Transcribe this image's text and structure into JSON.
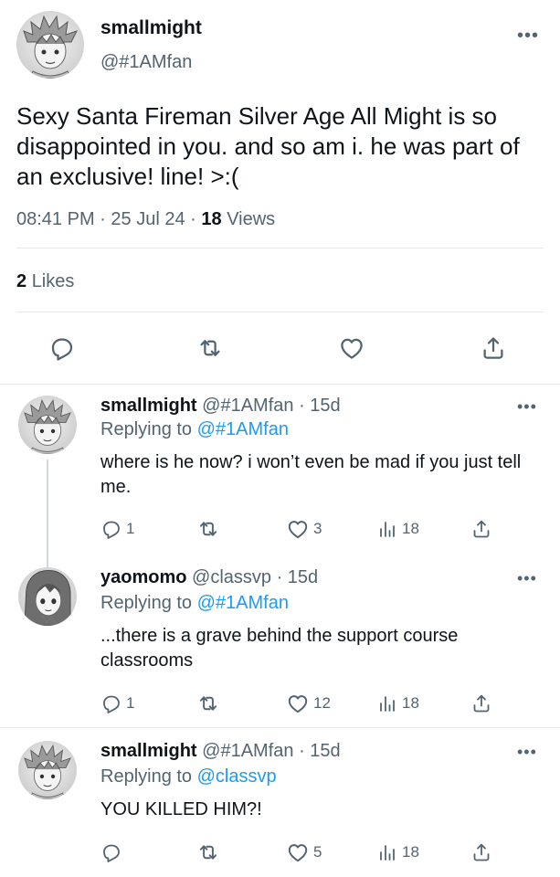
{
  "main": {
    "name": "smallmight",
    "handle": "@#1AMfan",
    "text": "Sexy Santa Fireman Silver Age All Might is so disappointed in you. and so am i. he was part of an exclusive! line! >:(",
    "time": "08:41 PM",
    "date": "25 Jul 24",
    "views_count": "18",
    "views_label": "Views",
    "likes_count": "2",
    "likes_label": "Likes",
    "separator": "·"
  },
  "replies": [
    {
      "name": "smallmight",
      "handle": "@#1AMfan",
      "age": "· 15d",
      "replying_label": "Replying to",
      "replying_to": "@#1AMfan",
      "text": "where is he now? i won’t even be mad if you just tell me.",
      "reply_count": "1",
      "retweet_count": "",
      "like_count": "3",
      "view_count": "18"
    },
    {
      "name": "yaomomo",
      "handle": "@classvp",
      "age": "· 15d",
      "replying_label": "Replying to",
      "replying_to": "@#1AMfan",
      "text": "...there is a grave behind the support course classrooms",
      "reply_count": "1",
      "retweet_count": "",
      "like_count": "12",
      "view_count": "18"
    },
    {
      "name": "smallmight",
      "handle": "@#1AMfan",
      "age": "· 15d",
      "replying_label": "Replying to",
      "replying_to": "@classvp",
      "text": "YOU KILLED HIM?!",
      "reply_count": "",
      "retweet_count": "",
      "like_count": "5",
      "view_count": "18"
    }
  ],
  "icons": {
    "reply": "reply-icon",
    "retweet": "retweet-icon",
    "like": "heart-icon",
    "views": "views-icon",
    "share": "share-icon",
    "more": "more-icon"
  },
  "colors": {
    "text": "#0f1419",
    "secondary": "#536471",
    "link": "#1d9bf0",
    "divider": "#e4e8eb"
  }
}
